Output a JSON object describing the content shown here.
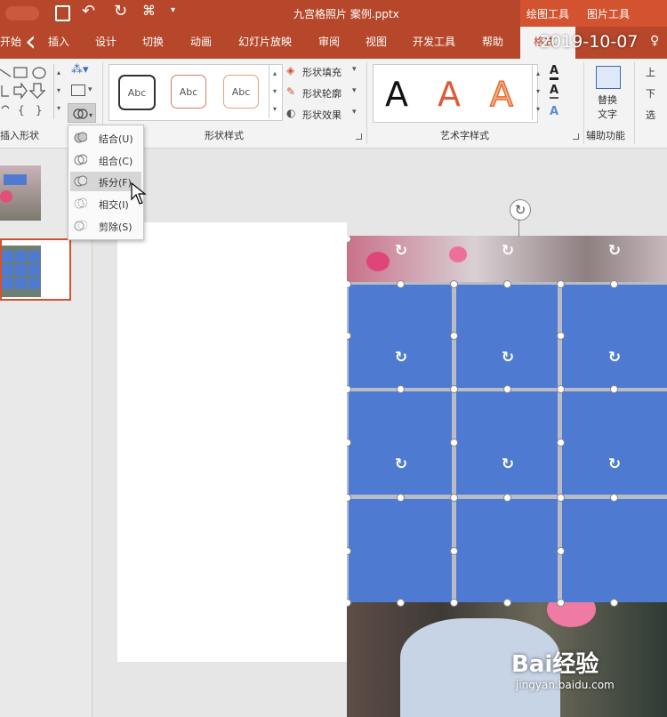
{
  "titlebar": {
    "file_title": "九宫格照片 案例.pptx",
    "context_tab_1": "绘图工具",
    "context_tab_2": "图片工具"
  },
  "tabs": [
    "开始",
    "插入",
    "设计",
    "切换",
    "动画",
    "幻灯片放映",
    "审阅",
    "视图",
    "开发工具",
    "帮助",
    "格式"
  ],
  "timestamp": "2019-10-07",
  "ribbon": {
    "insert_shapes_label": "插入形状",
    "shape_styles_label": "形状样式",
    "abc_label": "Abc",
    "shape_fill": "形状填充",
    "shape_outline": "形状轮廓",
    "shape_effects": "形状效果",
    "wordart_label": "艺术字样式",
    "wordart_glyph": "A",
    "alt_text_line1": "替换",
    "alt_text_line2": "文字",
    "accessibility_label": "辅助功能",
    "arrange_1": "上",
    "arrange_2": "下",
    "arrange_3": "选"
  },
  "merge_menu": {
    "items": [
      {
        "label": "结合(U)"
      },
      {
        "label": "组合(C)"
      },
      {
        "label": "拆分(F)"
      },
      {
        "label": "相交(I)"
      },
      {
        "label": "剪除(S)"
      }
    ],
    "highlighted_index": 2
  },
  "watermark": {
    "brand": "Bai经验",
    "url": "jingyan.baidu.com"
  },
  "colors": {
    "ribbon_accent": "#b7472a",
    "shape_fill": "#4e7bd1"
  }
}
